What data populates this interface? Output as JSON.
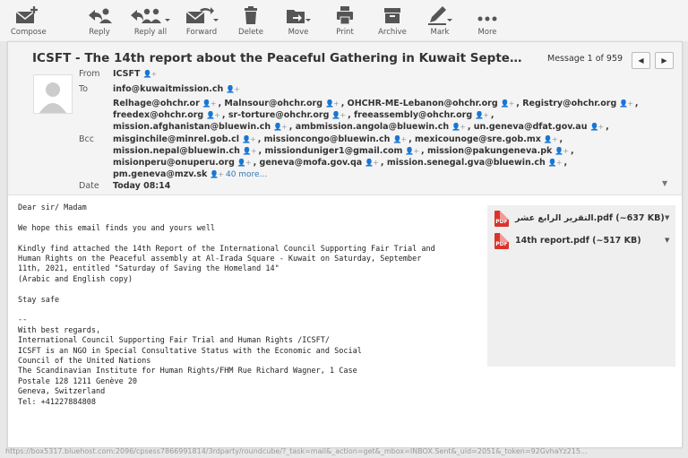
{
  "toolbar": {
    "compose": "Compose",
    "reply": "Reply",
    "reply_all": "Reply all",
    "forward": "Forward",
    "delete": "Delete",
    "move": "Move",
    "print": "Print",
    "archive": "Archive",
    "mark": "Mark",
    "more": "More",
    "icon_color": "#555555"
  },
  "message": {
    "subject": "ICSFT - The 14th report about the Peaceful Gathering in Kuwait Septe…",
    "counter": "Message 1 of 959",
    "labels": {
      "from": "From",
      "to": "To",
      "bcc": "Bcc",
      "date": "Date"
    },
    "from": "ICSFT",
    "to": "info@kuwaitmission.ch",
    "bcc_lines": [
      [
        "Relhage@ohchr.or",
        "Malnsour@ohchr.org",
        "OHCHR-ME-Lebanon@ohchr.org",
        "Registry@ohchr.org"
      ],
      [
        "freedex@ohchr.org",
        "sr-torture@ohchr.org",
        "freeassembly@ohchr.org"
      ],
      [
        "mission.afghanistan@bluewin.ch",
        "ambmission.angola@bluewin.ch",
        "un.geneva@dfat.gov.au"
      ],
      [
        "misginchile@minrel.gob.cl",
        "missioncongo@bluewin.ch",
        "mexicounoge@sre.gob.mx"
      ],
      [
        "mission.nepal@bluewin.ch",
        "missionduniger1@gmail.com",
        "mission@pakungeneva.pk"
      ],
      [
        "misionperu@onuperu.org",
        "geneva@mofa.gov.qa",
        "mission.senegal.gva@bluewin.ch"
      ],
      [
        "pm.geneva@mzv.sk"
      ]
    ],
    "more_link": "40 more...",
    "date": "Today 08:14"
  },
  "body_lines": [
    "Dear sir/ Madam",
    "",
    "We hope this email finds you and yours well",
    "",
    "Kindly find attached the 14th Report of the International Council Supporting Fair Trial and",
    "Human Rights on the Peaceful assembly at Al-Irada Square - Kuwait on Saturday, September",
    "11th, 2021, entitled \"Saturday of Saving the Homeland 14\"",
    "(Arabic and English copy)",
    "",
    "Stay safe",
    "",
    "--",
    "With best regards,",
    "International Council Supporting Fair Trial and Human Rights /ICSFT/",
    "ICSFT is an NGO in Special Consultative Status with the Economic and Social",
    "Council of the United Nations",
    "The Scandinavian Institute for Human Rights/FHM Rue Richard Wagner, 1 Case",
    "Postale 128 1211 Genève 20",
    "Geneva, Switzerland",
    "Tel: +41227884808"
  ],
  "attachments": [
    {
      "name": "التقرير الرابع عشر.pdf (~637 KB)",
      "type": "PDF"
    },
    {
      "name": "14th report.pdf (~517 KB)",
      "type": "PDF"
    }
  ],
  "status_url": "https://box5317.bluehost.com:2096/cpsess7866991814/3rdparty/roundcube/?_task=mail&_action=get&_mbox=INBOX.Sent&_uid=2051&_token=92GvhaYz215...",
  "colors": {
    "pdf_red": "#d9342b",
    "link_blue": "#3377bb"
  }
}
